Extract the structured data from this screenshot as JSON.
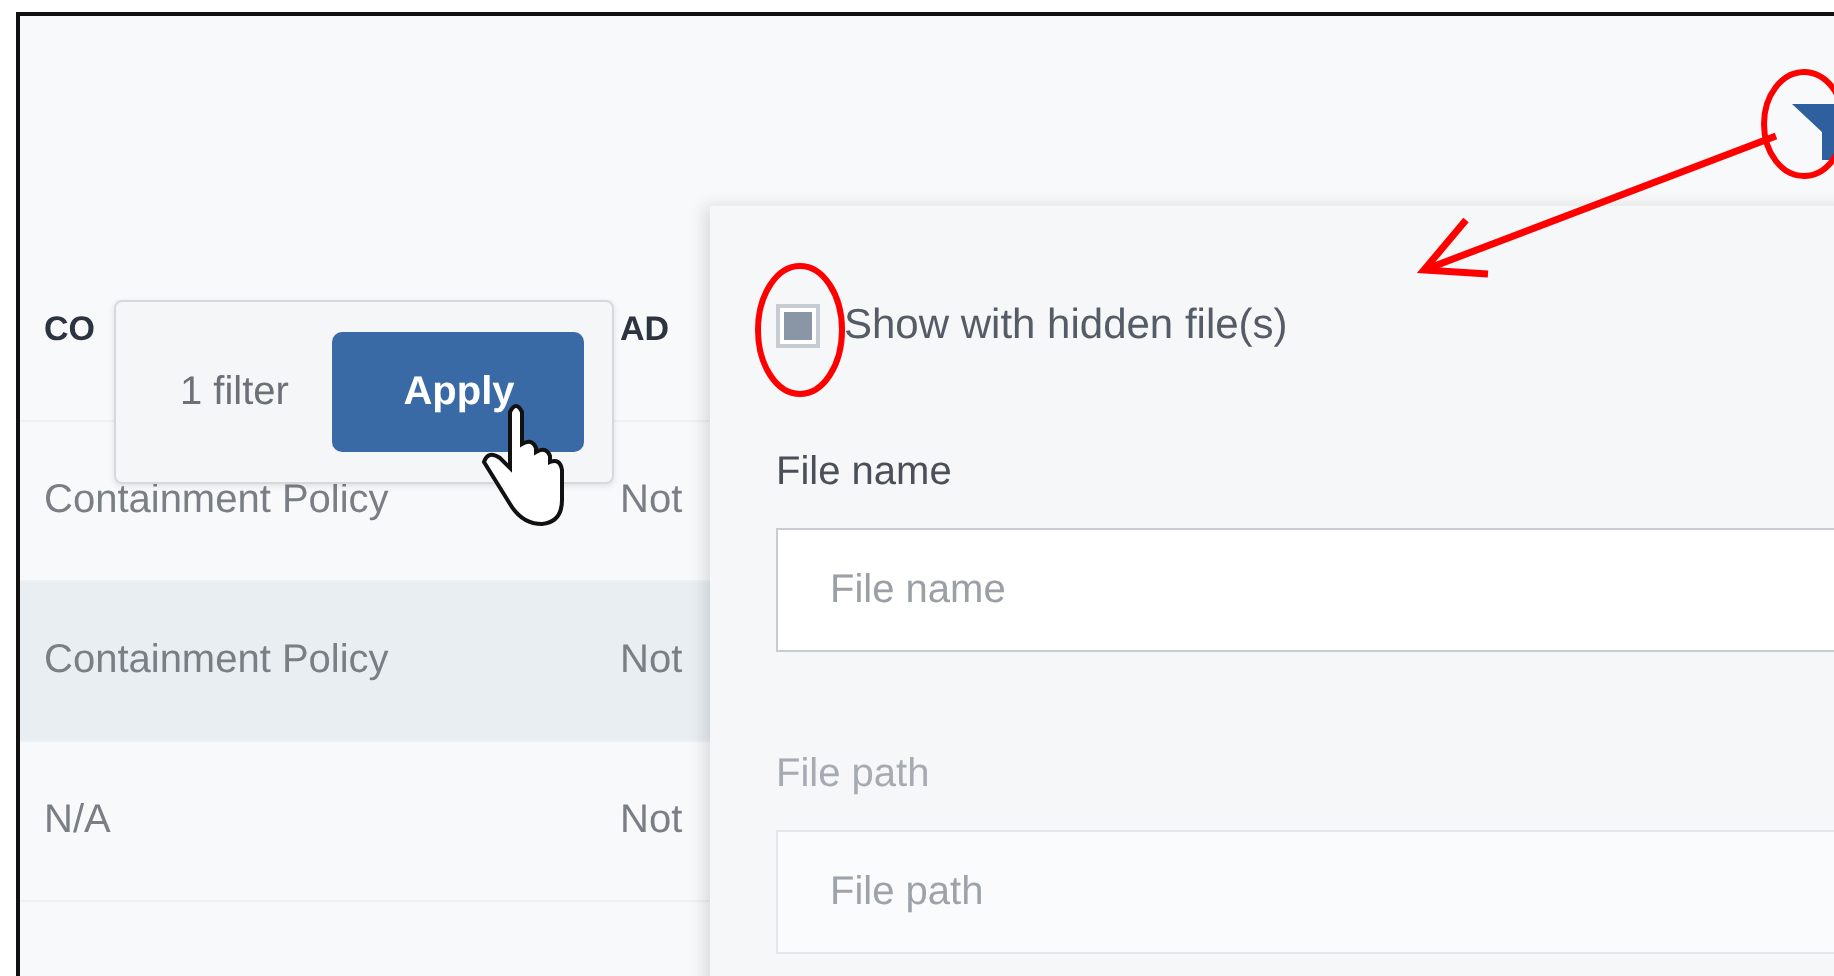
{
  "table": {
    "columns": [
      "CO",
      "AD"
    ],
    "rows": [
      {
        "cells": [
          "Containment Policy",
          "Not"
        ],
        "selected": false
      },
      {
        "cells": [
          "Containment Policy",
          "Not"
        ],
        "selected": true
      },
      {
        "cells": [
          "N/A",
          "Not"
        ],
        "selected": false
      }
    ]
  },
  "filter_popup": {
    "count": "1 filter",
    "apply": "Apply"
  },
  "filter_panel": {
    "hidden_files": {
      "label": "Show with hidden file(s)",
      "checked": true
    },
    "fields": [
      {
        "label": "File name",
        "placeholder": "File name",
        "faded": false
      },
      {
        "label": "File path",
        "placeholder": "File path",
        "faded": true
      }
    ]
  }
}
